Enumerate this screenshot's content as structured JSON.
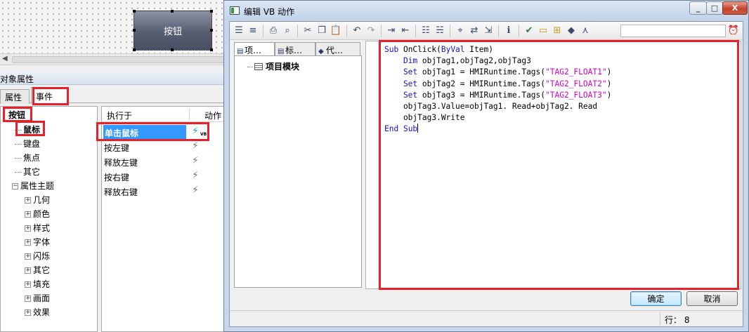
{
  "canvas": {
    "button_text": "按钮"
  },
  "properties": {
    "title": "对象属性",
    "tabs": [
      "属性",
      "事件"
    ],
    "tree": {
      "root": "按钮",
      "items": [
        "鼠标",
        "键盘",
        "焦点",
        "其它",
        "属性主题"
      ],
      "theme_children": [
        "几何",
        "颜色",
        "样式",
        "字体",
        "闪烁",
        "其它",
        "填充",
        "画面",
        "效果"
      ]
    },
    "events_header": {
      "col1": "执行于",
      "col2": "动作"
    },
    "events": [
      {
        "label": "单击鼠标",
        "vb_badge": "VB"
      },
      {
        "label": "按左键"
      },
      {
        "label": "释放左键"
      },
      {
        "label": "按右键"
      },
      {
        "label": "释放右键"
      }
    ]
  },
  "dialog": {
    "title": "编辑 VB 动作",
    "window_buttons": {
      "minimize": "_",
      "maximize": "□",
      "close": "X"
    },
    "left_tabs": [
      "项…",
      "标…",
      "代…"
    ],
    "left_tree_node": "项目模块",
    "code": {
      "l1a": "Sub",
      "l1b": " OnClick(",
      "l1c": "ByVal",
      "l1d": " Item)",
      "l2a": "    Dim",
      "l2b": " objTag1,objTag2,objTag3",
      "l3a": "    Set",
      "l3b": " objTag1 = HMIRuntime.Tags(",
      "l3c": "\"TAG2_FLOAT1\"",
      "l3d": ")",
      "l4a": "    Set",
      "l4b": " objTag2 = HMIRuntime.Tags(",
      "l4c": "\"TAG2_FLOAT2\"",
      "l4d": ")",
      "l5a": "    Set",
      "l5b": " objTag3 = HMIRuntime.Tags(",
      "l5c": "\"TAG2_FLOAT3\"",
      "l5d": ")",
      "l6": "    objTag3.Value=objTag1. Read+objTag2. Read",
      "l7": "    objTag3.Write",
      "l8a": "End",
      "l8b": " Sub"
    },
    "ok_label": "确定",
    "cancel_label": "取消",
    "status_line": "行： 8"
  }
}
